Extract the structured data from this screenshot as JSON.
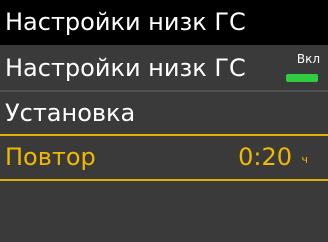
{
  "header": {
    "title": "Настройки низк ГС"
  },
  "menu": {
    "items": [
      {
        "label": "Настройки низк ГС",
        "status": "Вкл",
        "toggle_on": true,
        "toggle_color": "#2ecc40"
      },
      {
        "label": "Установка"
      },
      {
        "label": "Повтор",
        "value": "0:20",
        "unit": "ч",
        "selected": true,
        "highlight_color": "#f0b800"
      }
    ]
  }
}
